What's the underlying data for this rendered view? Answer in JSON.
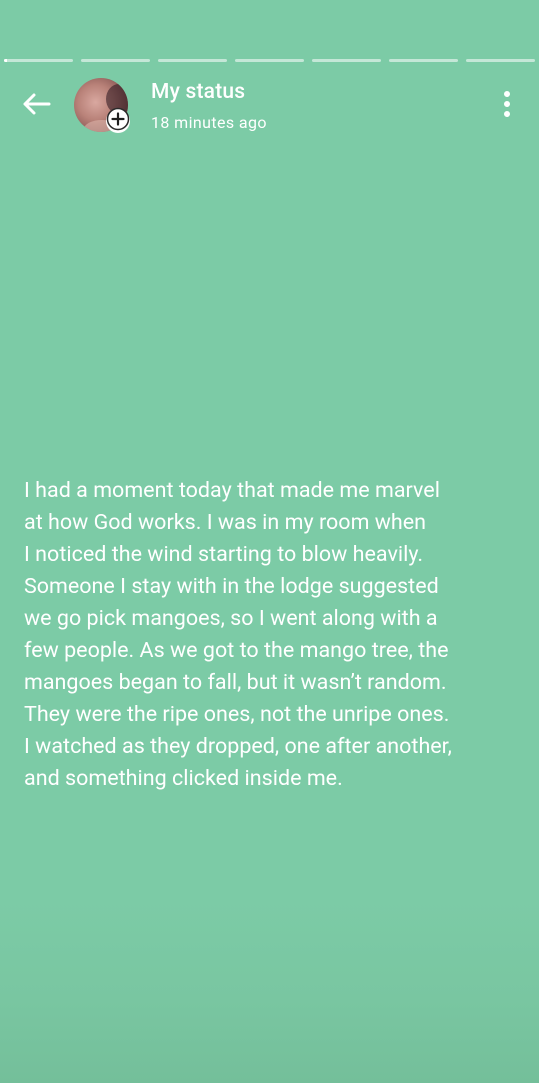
{
  "header": {
    "title": "My status",
    "timestamp": "18 minutes ago"
  },
  "progress": {
    "segments": 7,
    "current_index": 0,
    "current_fraction": 0.05
  },
  "icons": {
    "back": "arrow-left-icon",
    "add": "plus-icon",
    "menu": "more-vertical-icon"
  },
  "colors": {
    "background": "#7ccba6",
    "text": "#ffffff"
  },
  "status": {
    "text": "I had a moment today that made me marvel\nat how God works. I was in my room when\nI noticed the wind starting to blow heavily.\nSomeone I stay with in the lodge suggested\nwe go pick mangoes, so I went along with a\nfew people. As we got to the mango tree, the\nmangoes began to fall, but it wasn’t random.\nThey were the ripe ones, not the unripe ones.\nI watched as they dropped, one after another,\nand something clicked inside me."
  }
}
